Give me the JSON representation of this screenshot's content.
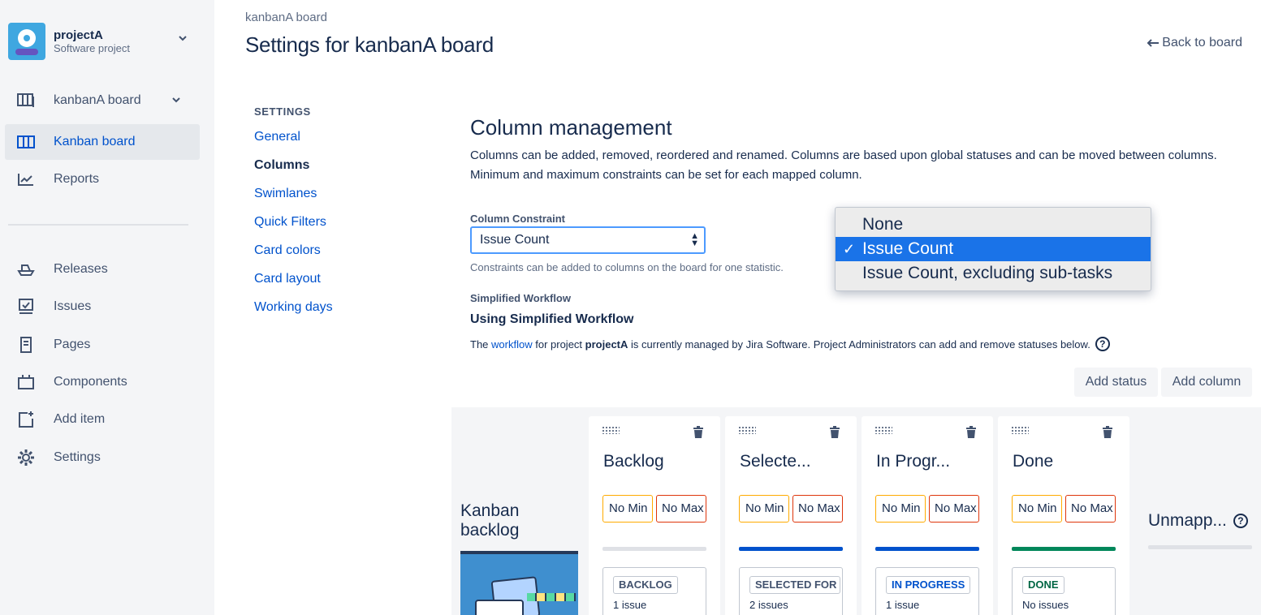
{
  "project": {
    "name": "projectA",
    "type": "Software project"
  },
  "sidebar": {
    "board_selector": "kanbanA board",
    "items": [
      {
        "label": "Kanban board",
        "icon": "board-icon"
      },
      {
        "label": "Reports",
        "icon": "chart-icon"
      },
      {
        "label": "Releases",
        "icon": "ship-icon"
      },
      {
        "label": "Issues",
        "icon": "issues-icon"
      },
      {
        "label": "Pages",
        "icon": "page-icon"
      },
      {
        "label": "Components",
        "icon": "component-icon"
      },
      {
        "label": "Add item",
        "icon": "add-item-icon"
      },
      {
        "label": "Settings",
        "icon": "gear-icon"
      }
    ]
  },
  "header": {
    "breadcrumb": "kanbanA board",
    "title": "Settings for kanbanA board",
    "back_link": "Back to board"
  },
  "settings_nav": {
    "heading": "SETTINGS",
    "items": [
      "General",
      "Columns",
      "Swimlanes",
      "Quick Filters",
      "Card colors",
      "Card layout",
      "Working days"
    ],
    "current": "Columns"
  },
  "main": {
    "title": "Column management",
    "description": "Columns can be added, removed, reordered and renamed. Columns are based upon global statuses and can be moved between columns. Minimum and maximum constraints can be set for each mapped column.",
    "constraint": {
      "label": "Column Constraint",
      "value": "Issue Count",
      "help": "Constraints can be added to columns on the board for one statistic.",
      "options": [
        "None",
        "Issue Count",
        "Issue Count, excluding sub-tasks"
      ],
      "selected_index": 1
    },
    "simplified_workflow": {
      "label": "Simplified Workflow",
      "title": "Using Simplified Workflow",
      "desc_prefix": "The",
      "desc_link": "workflow",
      "desc_mid": "for project",
      "desc_project": "projectA",
      "desc_suffix": "is currently managed by Jira Software. Project Administrators can add and remove statuses below."
    },
    "buttons": {
      "add_status": "Add status",
      "add_column": "Add column"
    }
  },
  "board": {
    "backlog_title_line1": "Kanban",
    "backlog_title_line2": "backlog",
    "columns": [
      {
        "name": "Backlog",
        "min": "No Min",
        "max": "No Max",
        "bar_color": "#dfe1e6",
        "status": "BACKLOG",
        "status_color": "#42526e",
        "count": "1 issue"
      },
      {
        "name": "Selecte...",
        "min": "No Min",
        "max": "No Max",
        "bar_color": "#0052cc",
        "status": "SELECTED FOR DEVELOPMENT",
        "status_color": "#42526e",
        "count": "2 issues"
      },
      {
        "name": "In Progr...",
        "min": "No Min",
        "max": "No Max",
        "bar_color": "#0052cc",
        "status": "IN PROGRESS",
        "status_color": "#0052cc",
        "count": "1 issue"
      },
      {
        "name": "Done",
        "min": "No Min",
        "max": "No Max",
        "bar_color": "#00875a",
        "status": "DONE",
        "status_color": "#006644",
        "count": "No issues"
      }
    ],
    "unmapped": "Unmapp..."
  }
}
